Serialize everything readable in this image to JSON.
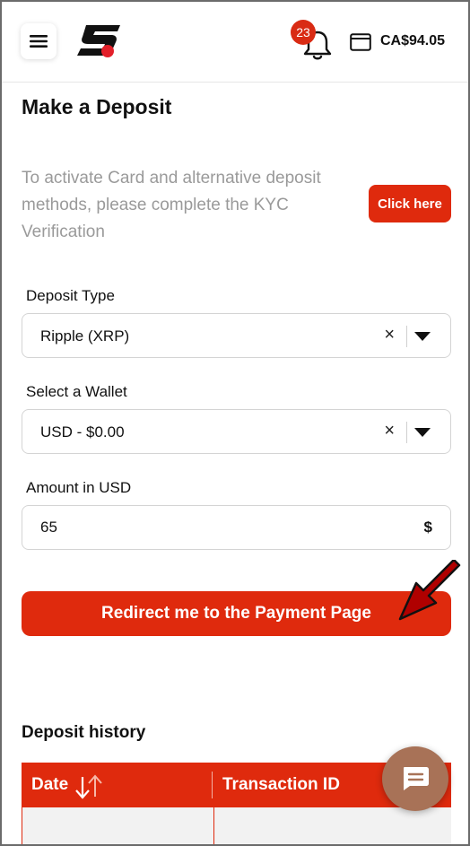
{
  "header": {
    "balance": "CA$94.05",
    "notification_count": "23",
    "icons": [
      "hamburger-icon",
      "logo",
      "bell-icon",
      "wallet-icon"
    ]
  },
  "deposit": {
    "title": "Make a Deposit",
    "kyc_message": "To activate Card and alternative deposit methods, please complete the KYC Verification",
    "kyc_button": "Click here",
    "deposit_type": {
      "label": "Deposit Type",
      "value": "Ripple (XRP)"
    },
    "wallet": {
      "label": "Select a Wallet",
      "value": "USD - $0.00"
    },
    "amount": {
      "label": "Amount in USD",
      "value": "65",
      "currency_symbol": "$"
    },
    "clear_symbol": "×",
    "submit_button": "Redirect me to the Payment Page"
  },
  "history": {
    "title": "Deposit history",
    "columns": [
      "Date",
      "Transaction ID"
    ]
  },
  "colors": {
    "accent": "#df2a0d",
    "chat_button": "#a87257",
    "annotation_arrow": "#b00000"
  }
}
